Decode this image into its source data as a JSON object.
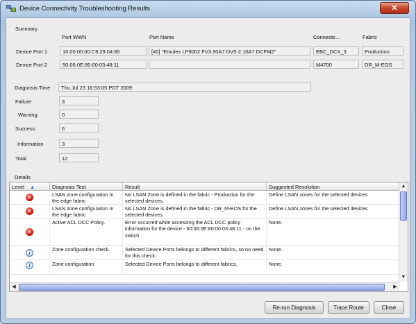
{
  "window": {
    "title": "Device Connectivity Troubleshooting Results",
    "close_glyph": "✕"
  },
  "summary": {
    "label": "Summary",
    "col_headers": {
      "port_wwn": "Port WWN",
      "port_name": "Port Name",
      "connected": "Connecte...",
      "fabric": "Fabric"
    },
    "ports": [
      {
        "label": "Device Port 1",
        "wwn": "10:00:00:00:C9:29:04:85",
        "name": "[40] \"Emulex LP9002 FV3.90A7  DV5-2.10A7 DCFM2\"",
        "connected": "EBC_DCX_3",
        "fabric": "Production"
      },
      {
        "label": "Device Port 2",
        "wwn": "50:06:0E:80:00:03:48:11",
        "name": "",
        "connected": "M4700",
        "fabric": "DR_M-EOS"
      }
    ]
  },
  "diagnosis": {
    "label": "Diagnosis Time",
    "value": "Thu Jul 23 16:53:05 PDT 2009"
  },
  "counts": {
    "failure": {
      "label": "Failure",
      "value": "3"
    },
    "warning": {
      "label": "Warning",
      "value": "0"
    },
    "success": {
      "label": "Success",
      "value": "6"
    },
    "information": {
      "label": "Information",
      "value": "3"
    },
    "total": {
      "label": "Total",
      "value": "12"
    }
  },
  "details": {
    "label": "Details",
    "columns": {
      "level": "Level",
      "level_sort": "▲",
      "test": "Diagnosis Test",
      "result": "Result",
      "resolution": "Suggested Resolution"
    },
    "rows": [
      {
        "level": "error",
        "icon": "✕",
        "test": "LSAN zone configuration in the edge fabric",
        "result": "No LSAN Zone is defined in the fabric - Production for the selected devices.",
        "resolution": "Define LSAN zones for the selected devices"
      },
      {
        "level": "error",
        "icon": "✕",
        "test": "LSAN zone configuration in the edge fabric",
        "result": "No LSAN Zone is defined in the fabric - DR_M-EOS for the selected devices.",
        "resolution": "Define LSAN zones for the selected devices"
      },
      {
        "level": "error",
        "icon": "✕",
        "test": "Active ACL DCC Policy.",
        "result": "Error occurred while accessing the ACL DCC policy information for the device - 50:06:0E:80:00:03:48:11 - on the switch .",
        "resolution": "None."
      },
      {
        "level": "info",
        "icon": "i",
        "test": "Zone configuration check.",
        "result": "Selected Device Ports belongs to different fabrics, so no need for this check.",
        "resolution": "None."
      },
      {
        "level": "info",
        "icon": "i",
        "test": "Zone configuration",
        "result": "Selected Device Ports belongs to different fabrics,",
        "resolution": "None."
      }
    ]
  },
  "scroll": {
    "up": "▲",
    "down": "▼",
    "left": "◀",
    "right": "▶"
  },
  "buttons": {
    "rerun": "Re-run Diagnosis",
    "trace": "Trace Route",
    "close": "Close"
  }
}
